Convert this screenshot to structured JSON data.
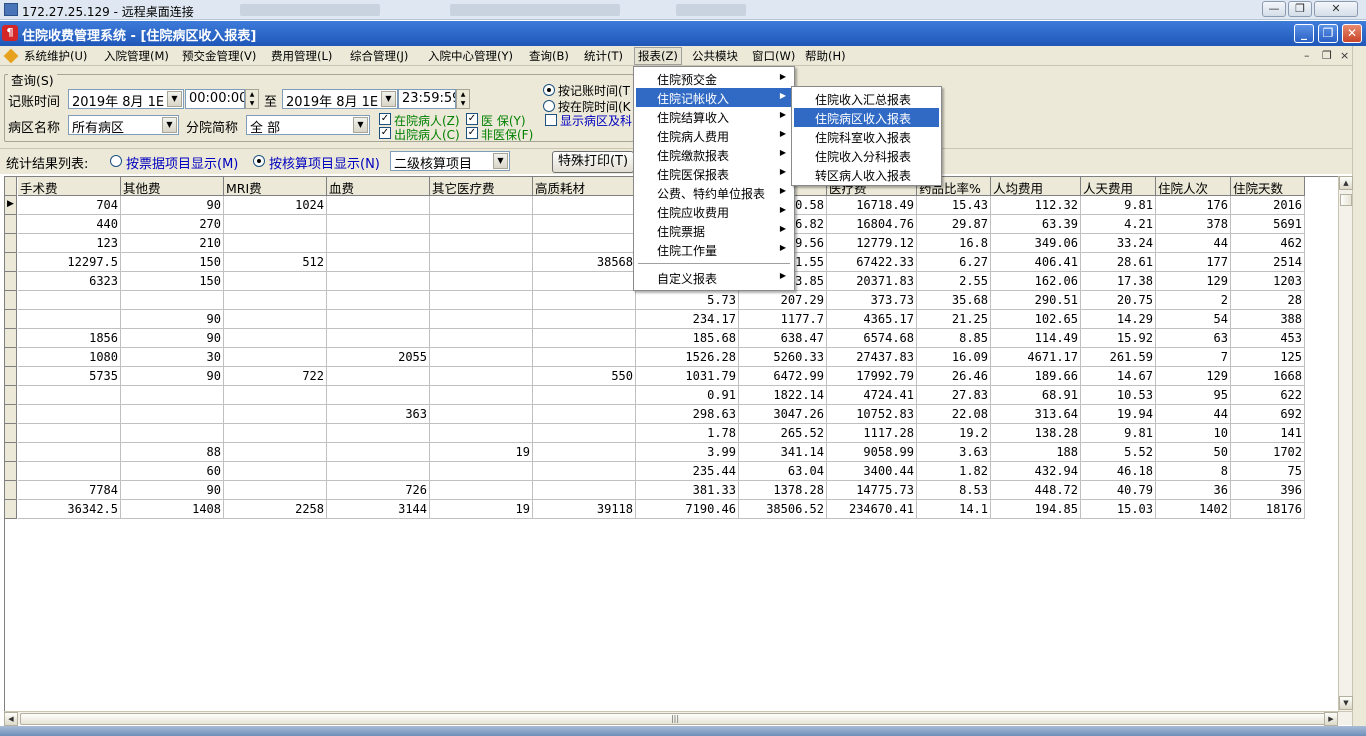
{
  "rdp": {
    "title": "172.27.25.129 - 远程桌面连接"
  },
  "app": {
    "title": "住院收费管理系统 - [住院病区收入报表]",
    "logo_char": "¶"
  },
  "menubar": {
    "items": [
      "系统维护(U)",
      "入院管理(M)",
      "预交金管理(V)",
      "费用管理(L)",
      "综合管理(J)",
      "入院中心管理(Y)",
      "查询(B)",
      "统计(T)",
      "报表(Z)",
      "公共模块",
      "窗口(W)",
      "帮助(H)"
    ],
    "active_index": 8
  },
  "query": {
    "legend": "查询(S)",
    "time_label": "记账时间",
    "start_date": "2019年 8月 1E",
    "start_time": "00:00:00",
    "to_label": "至",
    "end_date": "2019年 8月 1E",
    "end_time": "23:59:59",
    "ward_label": "病区名称",
    "ward_value": "所有病区",
    "branch_label": "分院简称",
    "branch_value": "全 部",
    "chk_inpatient": "在院病人(Z)",
    "chk_insurance": "医  保(Y)",
    "chk_discharged": "出院病人(C)",
    "chk_non_insurance": "非医保(F)",
    "radio_by_account": "按记账时间(T",
    "radio_by_stay": "按在院时间(K",
    "chk_show_ward": "显示病区及科"
  },
  "stats": {
    "label": "统计结果列表:",
    "radio_invoice": "按票据项目显示(M)",
    "radio_accounting": "按核算项目显示(N)",
    "level_select": "二级核算项目",
    "print_button": "特殊打印(T)"
  },
  "table": {
    "columns": [
      "手术费",
      "其他费",
      "MRI费",
      "血费",
      "其它医疗费",
      "高质耗材",
      "",
      "",
      "医疗费",
      "药品比率%",
      "人均费用",
      "人天费用",
      "住院人次",
      "住院天数"
    ],
    "rows": [
      [
        "704",
        "90",
        "1024",
        "",
        "",
        "",
        "",
        "0.58",
        "16718.49",
        "15.43",
        "112.32",
        "9.81",
        "176",
        "2016"
      ],
      [
        "440",
        "270",
        "",
        "",
        "",
        "",
        "",
        "6.82",
        "16804.76",
        "29.87",
        "63.39",
        "4.21",
        "378",
        "5691"
      ],
      [
        "123",
        "210",
        "",
        "",
        "",
        "",
        "",
        "9.56",
        "12779.12",
        "16.8",
        "349.06",
        "33.24",
        "44",
        "462"
      ],
      [
        "12297.5",
        "150",
        "512",
        "",
        "",
        "38568",
        "",
        "1.55",
        "67422.33",
        "6.27",
        "406.41",
        "28.61",
        "177",
        "2514"
      ],
      [
        "6323",
        "150",
        "",
        "",
        "",
        "",
        "",
        "3.85",
        "20371.83",
        "2.55",
        "162.06",
        "17.38",
        "129",
        "1203"
      ],
      [
        "",
        "",
        "",
        "",
        "",
        "",
        "5.73",
        "207.29",
        "373.73",
        "35.68",
        "290.51",
        "20.75",
        "2",
        "28"
      ],
      [
        "",
        "90",
        "",
        "",
        "",
        "",
        "234.17",
        "1177.7",
        "4365.17",
        "21.25",
        "102.65",
        "14.29",
        "54",
        "388"
      ],
      [
        "1856",
        "90",
        "",
        "",
        "",
        "",
        "185.68",
        "638.47",
        "6574.68",
        "8.85",
        "114.49",
        "15.92",
        "63",
        "453"
      ],
      [
        "1080",
        "30",
        "",
        "2055",
        "",
        "",
        "1526.28",
        "5260.33",
        "27437.83",
        "16.09",
        "4671.17",
        "261.59",
        "7",
        "125"
      ],
      [
        "5735",
        "90",
        "722",
        "",
        "",
        "550",
        "1031.79",
        "6472.99",
        "17992.79",
        "26.46",
        "189.66",
        "14.67",
        "129",
        "1668"
      ],
      [
        "",
        "",
        "",
        "",
        "",
        "",
        "0.91",
        "1822.14",
        "4724.41",
        "27.83",
        "68.91",
        "10.53",
        "95",
        "622"
      ],
      [
        "",
        "",
        "",
        "363",
        "",
        "",
        "298.63",
        "3047.26",
        "10752.83",
        "22.08",
        "313.64",
        "19.94",
        "44",
        "692"
      ],
      [
        "",
        "",
        "",
        "",
        "",
        "",
        "1.78",
        "265.52",
        "1117.28",
        "19.2",
        "138.28",
        "9.81",
        "10",
        "141"
      ],
      [
        "",
        "88",
        "",
        "",
        "19",
        "",
        "3.99",
        "341.14",
        "9058.99",
        "3.63",
        "188",
        "5.52",
        "50",
        "1702"
      ],
      [
        "",
        "60",
        "",
        "",
        "",
        "",
        "235.44",
        "63.04",
        "3400.44",
        "1.82",
        "432.94",
        "46.18",
        "8",
        "75"
      ],
      [
        "7784",
        "90",
        "",
        "726",
        "",
        "",
        "381.33",
        "1378.28",
        "14775.73",
        "8.53",
        "448.72",
        "40.79",
        "36",
        "396"
      ],
      [
        "36342.5",
        "1408",
        "2258",
        "3144",
        "19",
        "39118",
        "7190.46",
        "38506.52",
        "234670.41",
        "14.1",
        "194.85",
        "15.03",
        "1402",
        "18176"
      ]
    ]
  },
  "report_menu": {
    "items": [
      "住院预交金",
      "住院记帐收入",
      "住院结算收入",
      "住院病人费用",
      "住院缴款报表",
      "住院医保报表",
      "公费、特约单位报表",
      "住院应收费用",
      "住院票据",
      "住院工作量",
      "自定义报表"
    ],
    "highlighted_index": 1
  },
  "sub_menu": {
    "items": [
      "住院收入汇总报表",
      "住院病区收入报表",
      "住院科室收入报表",
      "住院收入分科报表",
      "转区病人收入报表"
    ],
    "highlighted_index": 1
  }
}
